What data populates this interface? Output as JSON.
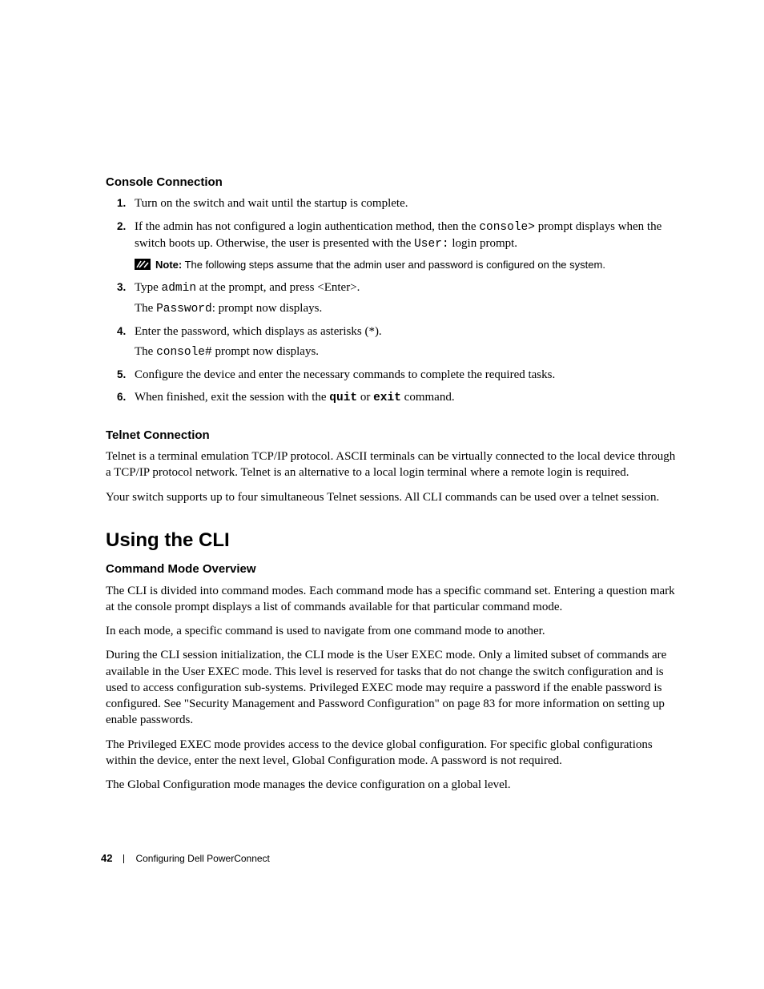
{
  "section_console": {
    "heading": "Console Connection",
    "steps": {
      "s1_num": "1.",
      "s1_text": "Turn on the switch and wait until the startup is complete.",
      "s2_num": "2.",
      "s2_pre": "If the admin has not configured a login authentication method, then the ",
      "s2_code1": "console>",
      "s2_mid": " prompt displays when the switch boots up. Otherwise, the user is presented with the ",
      "s2_code2": "User:",
      "s2_post": " login prompt.",
      "note_label": "Note:",
      "note_text": " The following steps assume that the admin user and password is configured on the system.",
      "s3_num": "3.",
      "s3_pre": "Type ",
      "s3_code": "admin",
      "s3_post": " at the prompt, and press <Enter>.",
      "s3_line2_pre": "The ",
      "s3_line2_code": "Password",
      "s3_line2_post": ": prompt now displays.",
      "s4_num": "4.",
      "s4_text": "Enter the password, which displays as asterisks (*).",
      "s4_line2_pre": "The ",
      "s4_line2_code": "console#",
      "s4_line2_post": " prompt now displays.",
      "s5_num": "5.",
      "s5_text": "Configure the device and enter the necessary commands to complete the required tasks.",
      "s6_num": "6.",
      "s6_pre": "When finished, exit the session with the ",
      "s6_code1": "quit",
      "s6_mid": " or ",
      "s6_code2": "exit",
      "s6_post": " command."
    }
  },
  "section_telnet": {
    "heading": "Telnet Connection",
    "p1": "Telnet is a terminal emulation TCP/IP protocol. ASCII terminals can be virtually connected to the local device through a TCP/IP protocol network. Telnet is an alternative to a local login terminal where a remote login is required.",
    "p2": "Your switch supports up to four simultaneous Telnet sessions. All CLI commands can be used over a telnet session."
  },
  "section_cli": {
    "heading": "Using the CLI",
    "sub_heading": "Command Mode Overview",
    "p1": "The CLI is divided into command modes. Each command mode has a specific command set. Entering a question mark at the console prompt displays a list of commands available for that particular command mode.",
    "p2": "In each mode, a specific command is used to navigate from one command mode to another.",
    "p3": "During the CLI session initialization, the CLI mode is the User EXEC mode. Only a limited subset of commands are available in the User EXEC mode. This level is reserved for tasks that do not change the switch configuration and is used to access configuration sub-systems. Privileged EXEC mode may require a password if the enable password is configured. See \"Security Management and Password Configuration\" on page 83 for more information on setting up enable passwords.",
    "p4": "The Privileged EXEC mode provides access to the device global configuration. For specific global configurations within the device, enter the next level, Global Configuration mode. A password is not required.",
    "p5": "The Global Configuration mode manages the device configuration on a global level."
  },
  "footer": {
    "page": "42",
    "title": "Configuring Dell PowerConnect"
  }
}
